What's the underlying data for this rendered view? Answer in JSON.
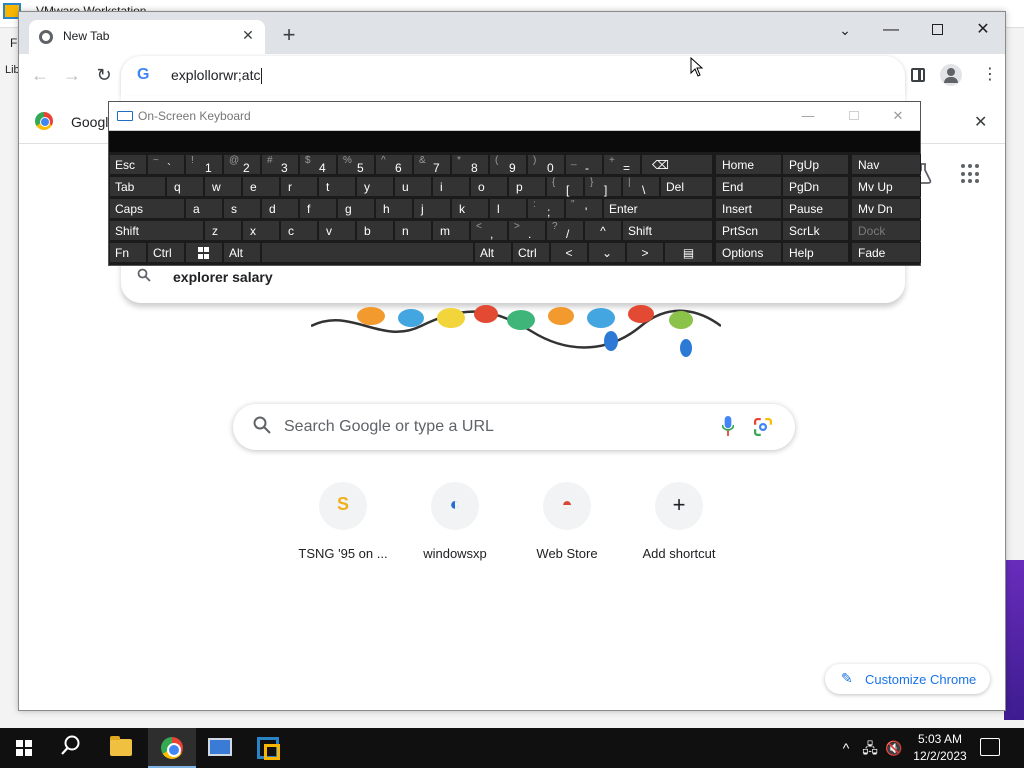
{
  "vm_window": {
    "title_fragment": "VMware Workstation",
    "menu_fragment": "F",
    "library_fragment": "Lib"
  },
  "chrome": {
    "tab": {
      "title": "New Tab",
      "close_glyph": "✕"
    },
    "new_tab_glyph": "+",
    "window_controls": {
      "chevron": "⌄",
      "minimize": "—",
      "close": "✕"
    },
    "nav": {
      "back": "←",
      "forward": "→",
      "reload": "↻"
    },
    "omnibox": {
      "provider_glyph": "G",
      "value": "explollorwr;atc"
    },
    "menu_glyph": "⋮",
    "notice_bar": {
      "text": "Google",
      "close_glyph": "✕"
    },
    "suggestions": [
      {
        "icon": "🔍",
        "text": "explorer salary"
      }
    ],
    "apps_glyph": "⋮⋮⋮",
    "search": {
      "placeholder": "Search Google or type a URL"
    },
    "shortcuts": [
      {
        "label": "TSNG '95 on ...",
        "glyph": "S",
        "color": "#f2b01e"
      },
      {
        "label": "windowsxp",
        "glyph": "◐",
        "color": "#1f6fd1"
      },
      {
        "label": "Web Store",
        "glyph": "◓",
        "color": "#db4437"
      },
      {
        "label": "Add shortcut",
        "glyph": "+",
        "color": "#202124"
      }
    ],
    "customize_label": "Customize Chrome",
    "customize_glyph": "✎"
  },
  "osk": {
    "title": "On-Screen Keyboard",
    "min_glyph": "—",
    "close_glyph": "✕",
    "keys": {
      "esc": "Esc",
      "tilde_s": "~",
      "tilde_m": "`",
      "k1_s": "!",
      "k1_m": "1",
      "k2_s": "@",
      "k2_m": "2",
      "k3_s": "#",
      "k3_m": "3",
      "k4_s": "$",
      "k4_m": "4",
      "k5_s": "%",
      "k5_m": "5",
      "k6_s": "^",
      "k6_m": "6",
      "k7_s": "&",
      "k7_m": "7",
      "k8_s": "*",
      "k8_m": "8",
      "k9_s": "(",
      "k9_m": "9",
      "k0_s": ")",
      "k0_m": "0",
      "minus_s": "_",
      "minus_m": "-",
      "eq_s": "+",
      "eq_m": "=",
      "bksp": "⌫",
      "tab": "Tab",
      "q": "q",
      "w": "w",
      "e": "e",
      "r": "r",
      "t": "t",
      "y": "y",
      "u": "u",
      "i": "i",
      "o": "o",
      "p": "p",
      "lbr_s": "{",
      "lbr_m": "[",
      "rbr_s": "}",
      "rbr_m": "]",
      "bsl_s": "|",
      "bsl_m": "\\",
      "del": "Del",
      "caps": "Caps",
      "a": "a",
      "s": "s",
      "d": "d",
      "f": "f",
      "g": "g",
      "h": "h",
      "j": "j",
      "k": "k",
      "l": "l",
      "semi_s": ":",
      "semi_m": ";",
      "quote_s": "\"",
      "quote_m": "'",
      "enter": "Enter",
      "shift_l": "Shift",
      "z": "z",
      "x": "x",
      "c": "c",
      "v": "v",
      "b": "b",
      "n": "n",
      "m": "m",
      "comma_s": "<",
      "comma_m": ",",
      "dot_s": ">",
      "dot_m": ".",
      "slash_s": "?",
      "slash_m": "/",
      "up": "^",
      "shift_r": "Shift",
      "fn": "Fn",
      "ctrl_l": "Ctrl",
      "alt_l": "Alt",
      "alt_r": "Alt",
      "ctrl_r": "Ctrl",
      "left": "<",
      "down": "⌄",
      "right": ">",
      "menu": "▤",
      "home": "Home",
      "pgup": "PgUp",
      "nav": "Nav",
      "end": "End",
      "pgdn": "PgDn",
      "mvup": "Mv Up",
      "insert": "Insert",
      "pause": "Pause",
      "mvdn": "Mv Dn",
      "prtscn": "PrtScn",
      "scrlk": "ScrLk",
      "dock": "Dock",
      "options": "Options",
      "help": "Help",
      "fade": "Fade"
    }
  },
  "taskbar": {
    "search_glyph": "⚲",
    "tray_chevron": "^",
    "net_glyph": "🖧",
    "vol_glyph": "🔇",
    "time": "5:03 AM",
    "date": "12/2/2023"
  }
}
